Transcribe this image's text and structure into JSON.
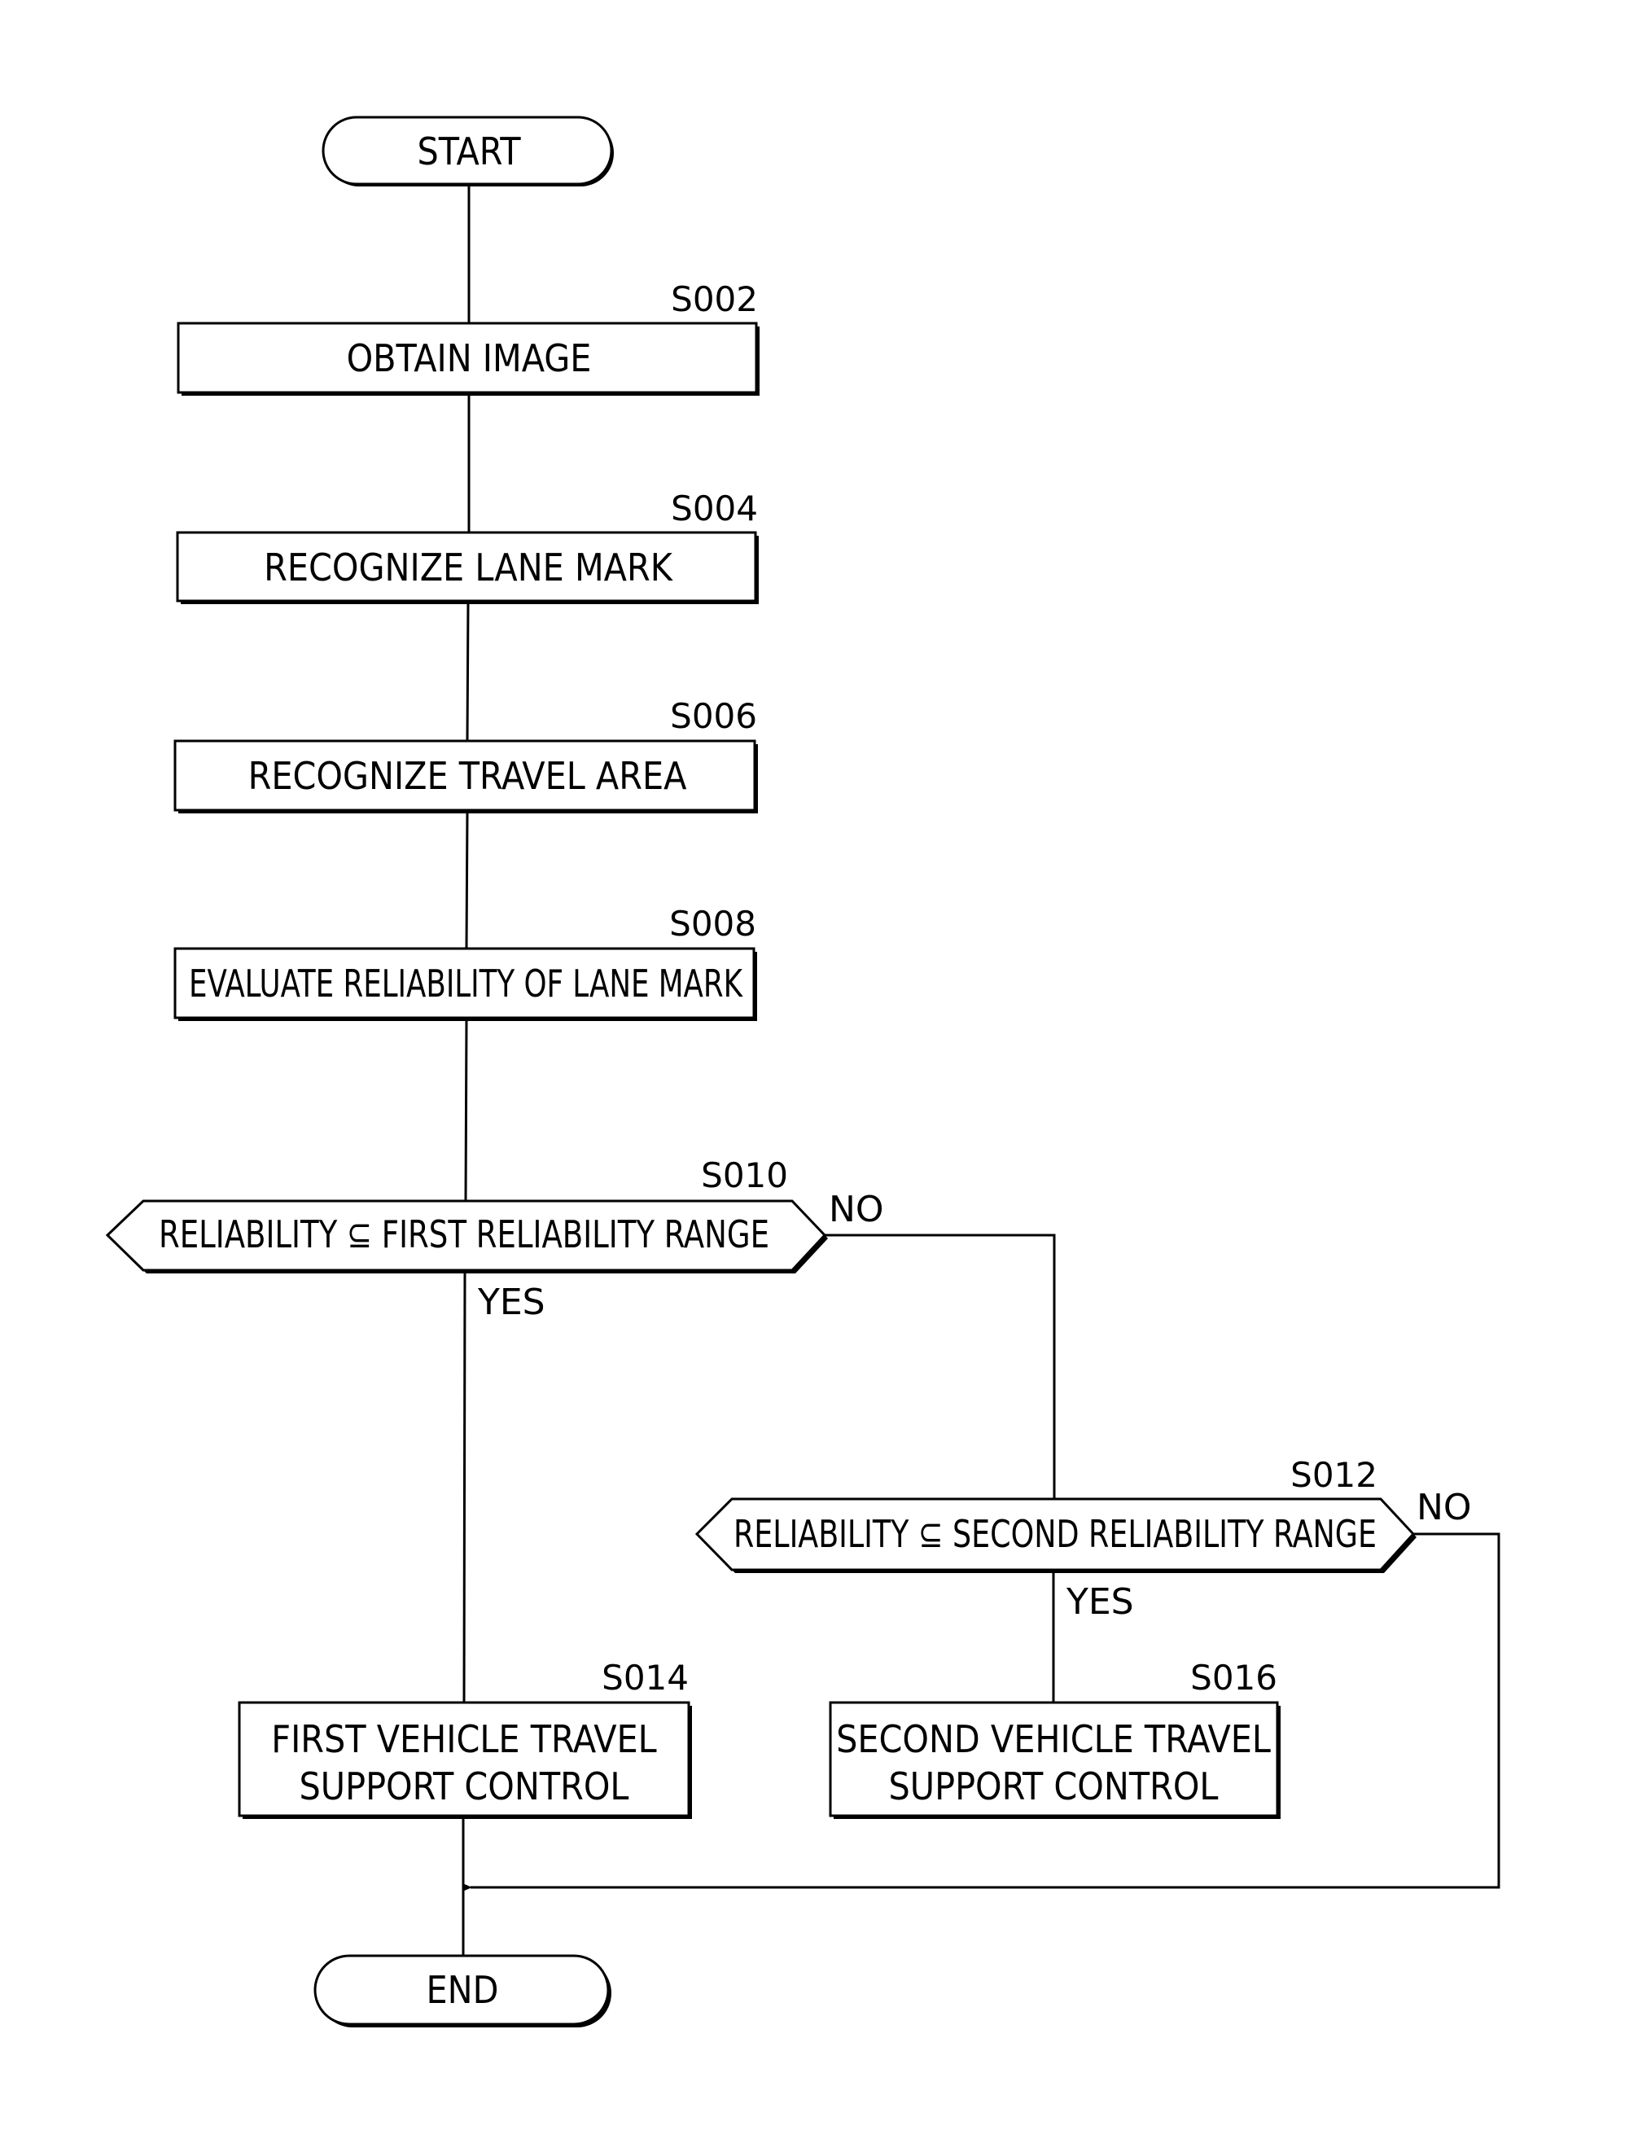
{
  "terminals": {
    "start": "START",
    "end": "END"
  },
  "steps": [
    {
      "id": "S002",
      "lines": [
        "OBTAIN IMAGE"
      ]
    },
    {
      "id": "S004",
      "lines": [
        "RECOGNIZE LANE MARK"
      ]
    },
    {
      "id": "S006",
      "lines": [
        "RECOGNIZE TRAVEL AREA"
      ]
    },
    {
      "id": "S008",
      "lines": [
        "EVALUATE RELIABILITY OF LANE MARK"
      ]
    },
    {
      "id": "S014",
      "lines": [
        "FIRST VEHICLE TRAVEL",
        "SUPPORT CONTROL"
      ]
    },
    {
      "id": "S016",
      "lines": [
        "SECOND VEHICLE TRAVEL",
        "SUPPORT CONTROL"
      ]
    }
  ],
  "decisions": [
    {
      "id": "S010",
      "text": "RELIABILITY ⊆ FIRST RELIABILITY RANGE",
      "yes": "YES",
      "no": "NO"
    },
    {
      "id": "S012",
      "text": "RELIABILITY ⊆ SECOND RELIABILITY RANGE",
      "yes": "YES",
      "no": "NO"
    }
  ]
}
